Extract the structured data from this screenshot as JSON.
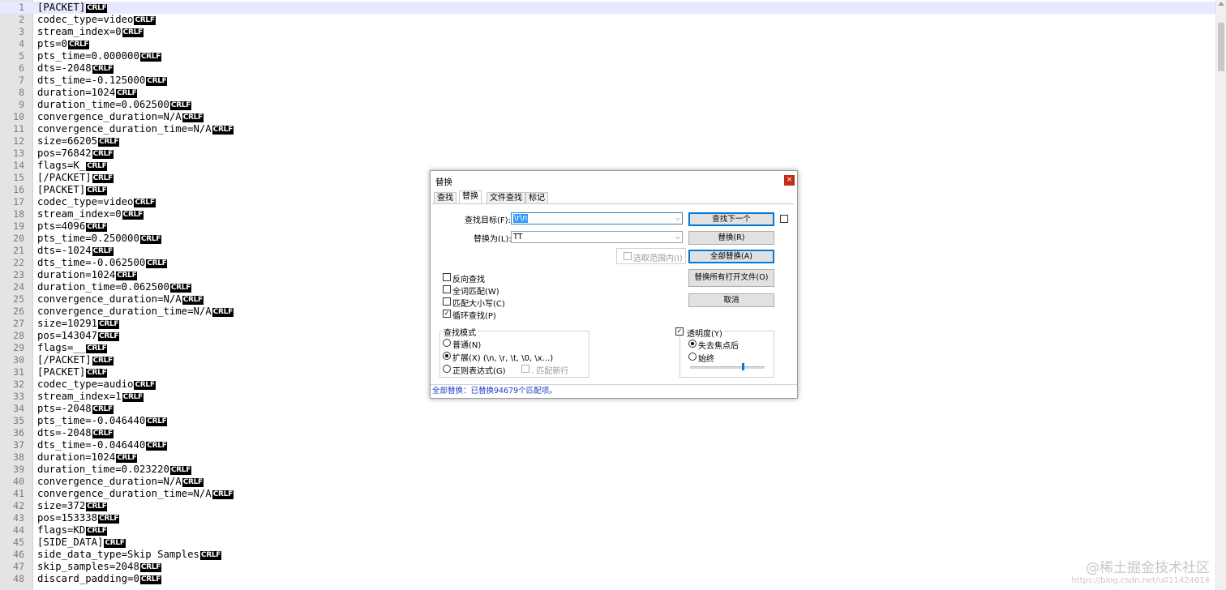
{
  "editor": {
    "lines": [
      {
        "n": "1",
        "t": "[PACKET]"
      },
      {
        "n": "2",
        "t": "codec_type=video"
      },
      {
        "n": "3",
        "t": "stream_index=0"
      },
      {
        "n": "4",
        "t": "pts=0"
      },
      {
        "n": "5",
        "t": "pts_time=0.000000"
      },
      {
        "n": "6",
        "t": "dts=-2048"
      },
      {
        "n": "7",
        "t": "dts_time=-0.125000"
      },
      {
        "n": "8",
        "t": "duration=1024"
      },
      {
        "n": "9",
        "t": "duration_time=0.062500"
      },
      {
        "n": "10",
        "t": "convergence_duration=N/A"
      },
      {
        "n": "11",
        "t": "convergence_duration_time=N/A"
      },
      {
        "n": "12",
        "t": "size=66205"
      },
      {
        "n": "13",
        "t": "pos=76842"
      },
      {
        "n": "14",
        "t": "flags=K_"
      },
      {
        "n": "15",
        "t": "[/PACKET]"
      },
      {
        "n": "16",
        "t": "[PACKET]"
      },
      {
        "n": "17",
        "t": "codec_type=video"
      },
      {
        "n": "18",
        "t": "stream_index=0"
      },
      {
        "n": "19",
        "t": "pts=4096"
      },
      {
        "n": "20",
        "t": "pts_time=0.250000"
      },
      {
        "n": "21",
        "t": "dts=-1024"
      },
      {
        "n": "22",
        "t": "dts_time=-0.062500"
      },
      {
        "n": "23",
        "t": "duration=1024"
      },
      {
        "n": "24",
        "t": "duration_time=0.062500"
      },
      {
        "n": "25",
        "t": "convergence_duration=N/A"
      },
      {
        "n": "26",
        "t": "convergence_duration_time=N/A"
      },
      {
        "n": "27",
        "t": "size=10291"
      },
      {
        "n": "28",
        "t": "pos=143047"
      },
      {
        "n": "29",
        "t": "flags=__"
      },
      {
        "n": "30",
        "t": "[/PACKET]"
      },
      {
        "n": "31",
        "t": "[PACKET]"
      },
      {
        "n": "32",
        "t": "codec_type=audio"
      },
      {
        "n": "33",
        "t": "stream_index=1"
      },
      {
        "n": "34",
        "t": "pts=-2048"
      },
      {
        "n": "35",
        "t": "pts_time=-0.046440"
      },
      {
        "n": "36",
        "t": "dts=-2048"
      },
      {
        "n": "37",
        "t": "dts_time=-0.046440"
      },
      {
        "n": "38",
        "t": "duration=1024"
      },
      {
        "n": "39",
        "t": "duration_time=0.023220"
      },
      {
        "n": "40",
        "t": "convergence_duration=N/A"
      },
      {
        "n": "41",
        "t": "convergence_duration_time=N/A"
      },
      {
        "n": "42",
        "t": "size=372"
      },
      {
        "n": "43",
        "t": "pos=153338"
      },
      {
        "n": "44",
        "t": "flags=KD"
      },
      {
        "n": "45",
        "t": "[SIDE_DATA]"
      },
      {
        "n": "46",
        "t": "side_data_type=Skip Samples"
      },
      {
        "n": "47",
        "t": "skip_samples=2048"
      },
      {
        "n": "48",
        "t": "discard_padding=0"
      }
    ],
    "eol_marker": "CRLF"
  },
  "watermark": {
    "line1": "@稀土掘金技术社区",
    "line2": "https://blog.csdn.net/u011424614"
  },
  "dialog": {
    "title": "替换",
    "close_glyph": "×",
    "tabs": [
      "查找",
      "替换",
      "文件查找",
      "标记"
    ],
    "active_tab": "替换",
    "find_label": "查找目标(F):",
    "find_value": "\\r\\n",
    "replace_label": "替换为(L):",
    "replace_value": "TT",
    "dropdown_glyph": "⌵",
    "in_selection_label": "选取范围内(I)",
    "btn_find_next": "查找下一个",
    "btn_replace": "替换(R)",
    "btn_replace_all": "全部替换(A)",
    "btn_replace_all_open": "替换所有打开文件(O)",
    "btn_cancel": "取消",
    "opt_backward": "反向查找",
    "opt_whole_word": "全词匹配(W)",
    "opt_match_case": "匹配大小写(C)",
    "opt_wrap": "循环查找(P)",
    "mode_group_label": "查找模式",
    "mode_normal": "普通(N)",
    "mode_extended": "扩展(X) (\\n, \\r, \\t, \\0, \\x...)",
    "mode_regex": "正则表达式(G)",
    "dot_newline": ". 匹配新行",
    "transparency_label": "透明度(Y)",
    "trans_lose_focus": "失去焦点后",
    "trans_always": "始终",
    "status": "全部替换：已替换94679个匹配项。",
    "check_glyph": "✓",
    "selected_mode": "extended",
    "selected_transparency": "lose_focus",
    "transparency_level": 0.72
  },
  "colors": {
    "status_text": "#1a3dc8",
    "accent": "#0078d7",
    "close_button": "#c42b1c"
  }
}
